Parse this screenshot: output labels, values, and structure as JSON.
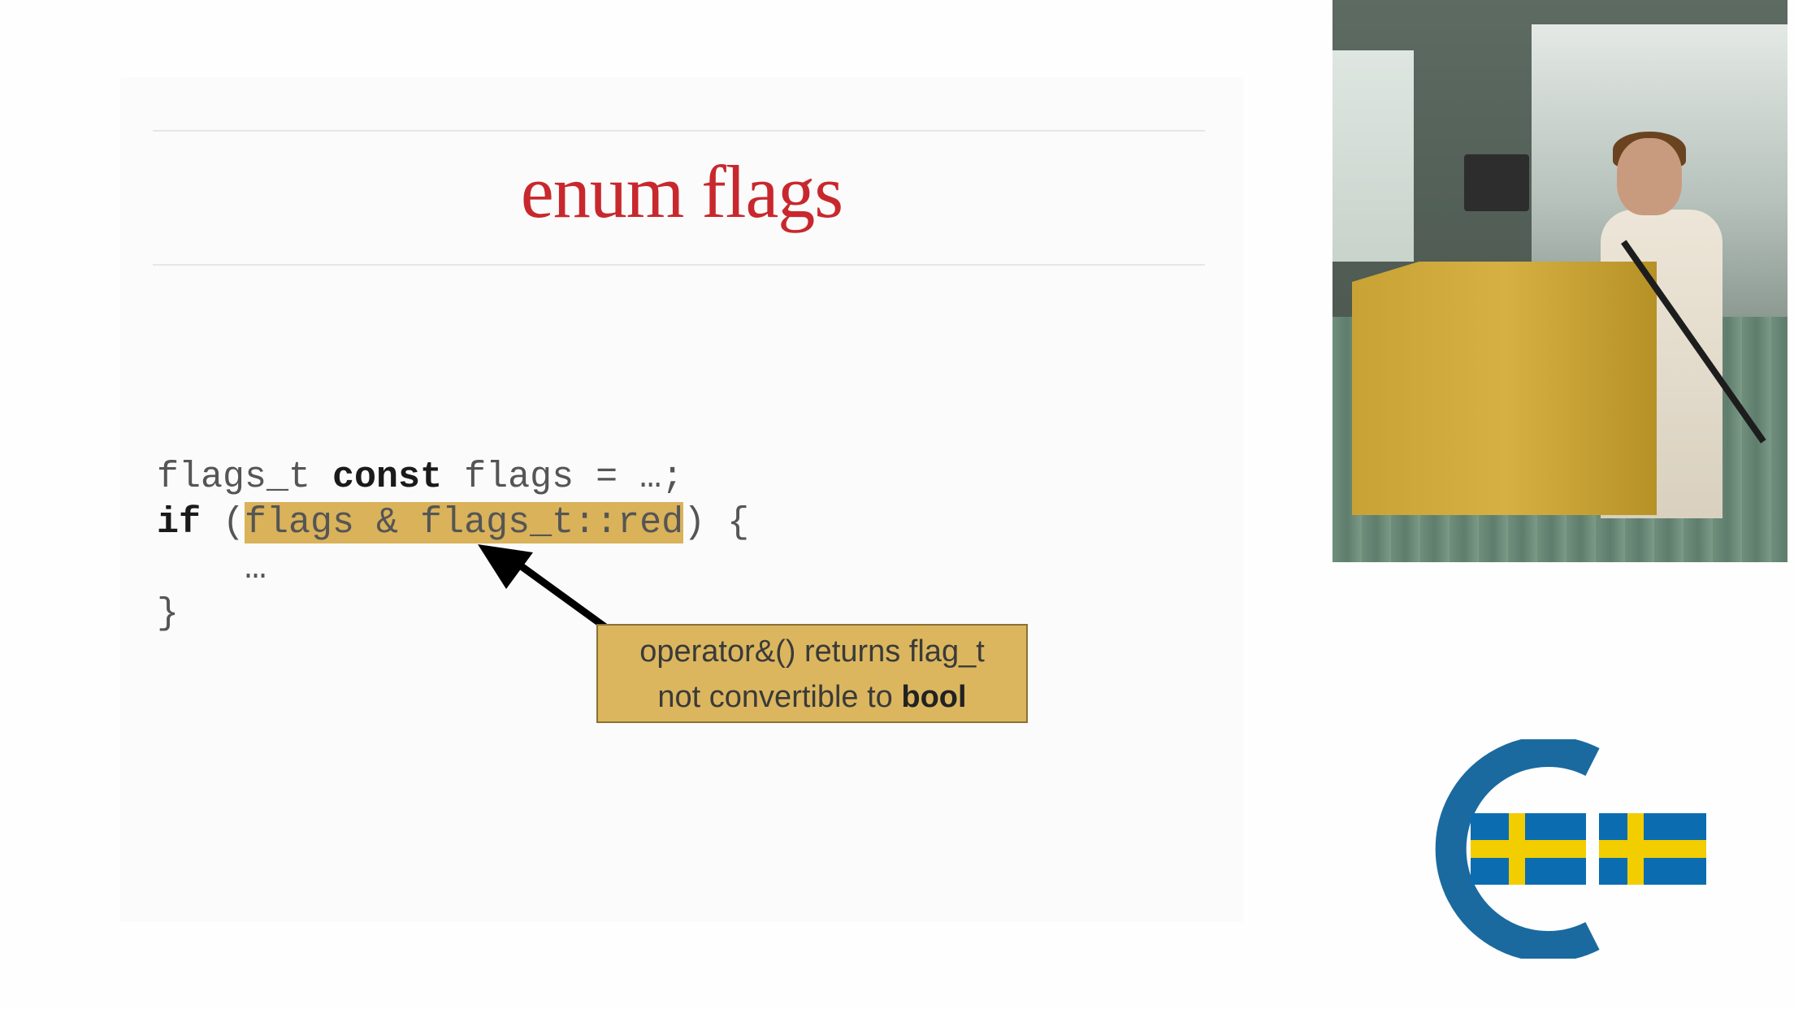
{
  "slide": {
    "title": "enum flags",
    "code": {
      "line1_a": "flags_t ",
      "line1_kw": "const",
      "line1_b": " flags = …;",
      "line2_kw": "if",
      "line2_a": " (",
      "line2_hl": "flags & flags_t::red",
      "line2_b": ") {",
      "line3": "    …",
      "line4": "}"
    },
    "callout": {
      "line1": "operator&() returns flag_t",
      "line2_a": "not convertible to ",
      "line2_bold": "bool"
    }
  },
  "colors": {
    "title": "#c8282d",
    "highlight": "#d9b25a",
    "callout_bg": "#dbb65e",
    "logo_blue": "#1a6aa0",
    "logo_yellow": "#f2cd00",
    "logo_flag_blue": "#0b6db0"
  },
  "icons": {
    "arrow": "arrow-icon",
    "logo": "conference-logo-icon"
  }
}
